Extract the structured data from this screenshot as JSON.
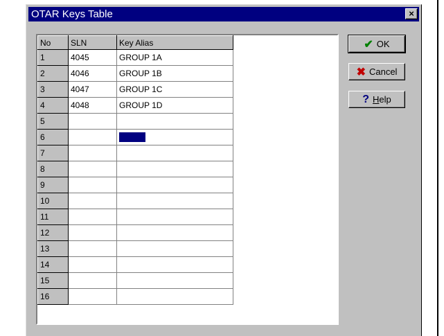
{
  "dialog": {
    "title": "OTAR Keys Table",
    "close_label": "×"
  },
  "grid": {
    "columns": [
      "No",
      "SLN",
      "Key Alias"
    ],
    "rows": [
      {
        "no": "1",
        "sln": "4045",
        "alias": "GROUP 1A"
      },
      {
        "no": "2",
        "sln": "4046",
        "alias": "GROUP 1B"
      },
      {
        "no": "3",
        "sln": "4047",
        "alias": "GROUP 1C"
      },
      {
        "no": "4",
        "sln": "4048",
        "alias": "GROUP 1D"
      },
      {
        "no": "5",
        "sln": "",
        "alias": ""
      },
      {
        "no": "6",
        "sln": "",
        "alias": ""
      },
      {
        "no": "7",
        "sln": "",
        "alias": ""
      },
      {
        "no": "8",
        "sln": "",
        "alias": ""
      },
      {
        "no": "9",
        "sln": "",
        "alias": ""
      },
      {
        "no": "10",
        "sln": "",
        "alias": ""
      },
      {
        "no": "11",
        "sln": "",
        "alias": ""
      },
      {
        "no": "12",
        "sln": "",
        "alias": ""
      },
      {
        "no": "13",
        "sln": "",
        "alias": ""
      },
      {
        "no": "14",
        "sln": "",
        "alias": ""
      },
      {
        "no": "15",
        "sln": "",
        "alias": ""
      },
      {
        "no": "16",
        "sln": "",
        "alias": ""
      }
    ]
  },
  "buttons": {
    "ok": {
      "label": "OK",
      "icon": "checkmark-icon"
    },
    "cancel": {
      "label": "Cancel",
      "icon": "x-icon"
    },
    "help": {
      "label_accel": "H",
      "label_rest": "elp",
      "icon": "question-icon"
    }
  },
  "colors": {
    "titlebar": "#000080",
    "face": "#c0c0c0",
    "selection": "#000080"
  }
}
